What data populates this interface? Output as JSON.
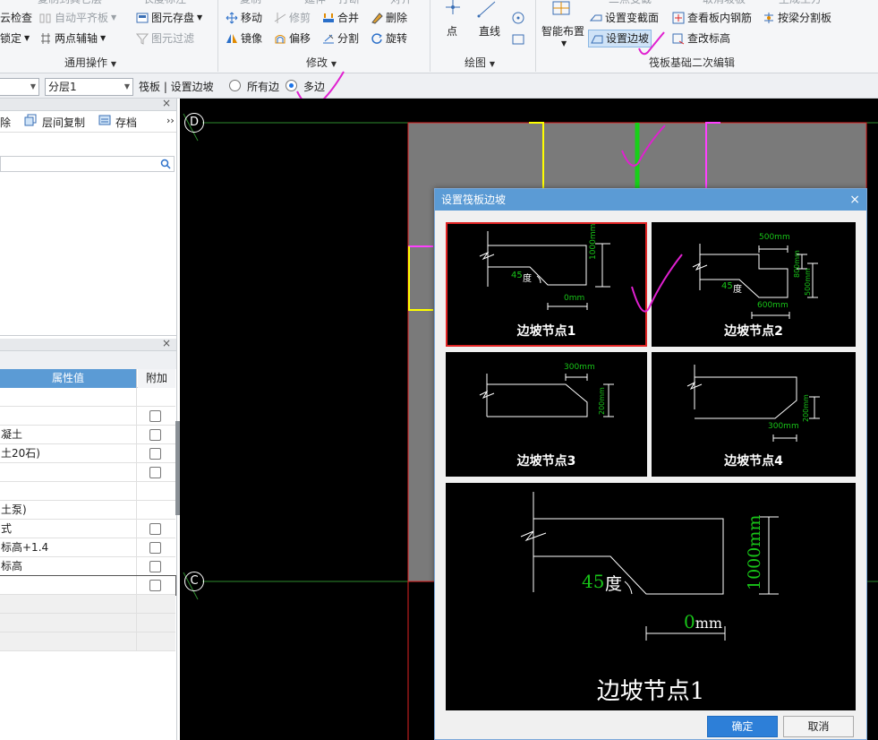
{
  "ribbon": {
    "top_row_partial": [
      "复制到其它层",
      "长度标注",
      "复制",
      "延伸",
      "打断",
      "对齐",
      "二点变截",
      "取消坡板",
      "生成土方"
    ],
    "general_ops": {
      "items": [
        "云检查",
        "自动平齐板",
        "锁定",
        "两点辅轴",
        "图元存盘",
        "图元过滤"
      ],
      "label": "通用操作"
    },
    "modify": {
      "items": [
        "移动",
        "修剪",
        "合并",
        "删除",
        "镜像",
        "偏移",
        "分割",
        "旋转"
      ],
      "label": "修改"
    },
    "draw": {
      "items": [
        "点",
        "直线"
      ],
      "label": "绘图"
    },
    "raft": {
      "smart_layout": "智能布置",
      "items": [
        "设置变截面",
        "查看板内钢筋",
        "按梁分割板",
        "设置边坡",
        "查改标高"
      ],
      "label": "筏板基础二次编辑"
    }
  },
  "toolbar": {
    "combo1": "",
    "combo2": "分层1",
    "breadcrumb": "筏板 | 设置边坡",
    "radio_all": "所有边",
    "radio_multi": "多边",
    "selected": "多边"
  },
  "left_panel": {
    "tools": [
      "除",
      "层间复制",
      "存档"
    ],
    "more": "››",
    "search_placeholder": ""
  },
  "props": {
    "header_value": "属性值",
    "header_extra": "附加",
    "rows": [
      {
        "value": "",
        "check": false,
        "has_check": false
      },
      {
        "value": "",
        "check": false,
        "has_check": true
      },
      {
        "value": "凝土",
        "check": false,
        "has_check": true
      },
      {
        "value": "土20石)",
        "check": false,
        "has_check": true
      },
      {
        "value": "",
        "check": false,
        "has_check": true
      },
      {
        "value": "",
        "check": false,
        "has_check": false
      },
      {
        "value": "土泵)",
        "check": false,
        "has_check": false
      },
      {
        "value": "式",
        "check": false,
        "has_check": true
      },
      {
        "value": "标高+1.4",
        "check": false,
        "has_check": true
      },
      {
        "value": "标高",
        "check": false,
        "has_check": true
      },
      {
        "value": "",
        "check": false,
        "has_check": true
      },
      {
        "value": "",
        "check": false,
        "has_check": false
      },
      {
        "value": "",
        "check": false,
        "has_check": false
      },
      {
        "value": "",
        "check": false,
        "has_check": false
      }
    ]
  },
  "canvas": {
    "axis_labels": [
      "D",
      "C"
    ]
  },
  "dialog": {
    "title": "设置筏板边坡",
    "nodes": [
      {
        "label": "边坡节点1",
        "dims": [
          "45度",
          "1000mm",
          "0mm"
        ],
        "selected": true
      },
      {
        "label": "边坡节点2",
        "dims": [
          "500mm",
          "800mm",
          "500mm",
          "45度",
          "600mm"
        ],
        "selected": false
      },
      {
        "label": "边坡节点3",
        "dims": [
          "300mm",
          "200mm"
        ],
        "selected": false
      },
      {
        "label": "边坡节点4",
        "dims": [
          "200mm",
          "300mm"
        ],
        "selected": false
      }
    ],
    "preview": {
      "label": "边坡节点1",
      "angle": "45",
      "angle_unit": "度",
      "height": "1000",
      "height_unit": "mm",
      "width": "0",
      "width_unit": "mm"
    },
    "ok": "确定",
    "cancel": "取消"
  },
  "colors": {
    "accent": "#5b9bd5",
    "dim_green": "#18c418",
    "annotation": "#e020d0",
    "selection": "#e02424"
  }
}
